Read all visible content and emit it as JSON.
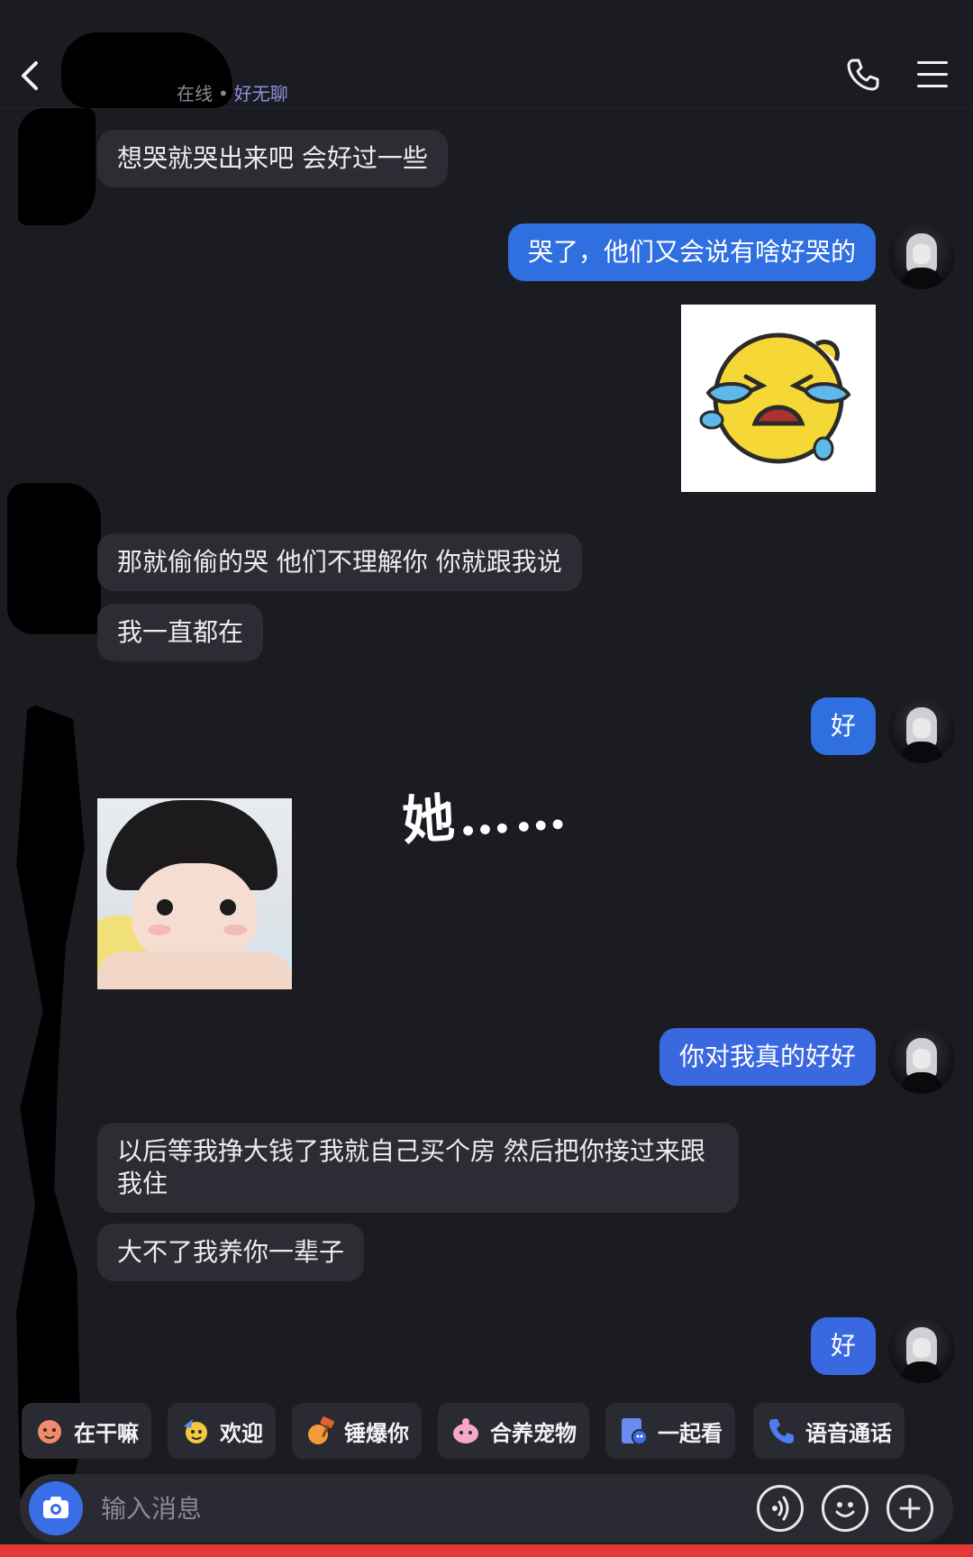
{
  "header": {
    "status_online": "在线",
    "status_sep": "•",
    "status_mood": "好无聊"
  },
  "messages": [
    {
      "from": "them",
      "text": "想哭就哭出来吧 会好过一些"
    },
    {
      "from": "me",
      "text": "哭了，他们又会说有啥好哭的"
    },
    {
      "from": "me",
      "type": "sticker",
      "sticker": "crying-face-sticker"
    },
    {
      "from": "them",
      "text": "那就偷偷的哭 他们不理解你 你就跟我说"
    },
    {
      "from": "them",
      "text": "我一直都在"
    },
    {
      "from": "me",
      "text": "好"
    },
    {
      "from": "them",
      "type": "sticker",
      "sticker": "baby-photo-sticker"
    },
    {
      "from": "me",
      "text": "你对我真的好好"
    },
    {
      "from": "them",
      "text": "以后等我挣大钱了我就自己买个房 然后把你接过来跟我住"
    },
    {
      "from": "them",
      "text": "大不了我养你一辈子"
    },
    {
      "from": "me",
      "text": "好"
    }
  ],
  "overlay_text": "她……",
  "quick_actions": [
    {
      "label": "在干嘛",
      "icon": "wave-hand-icon"
    },
    {
      "label": "欢迎",
      "icon": "party-face-icon"
    },
    {
      "label": "锤爆你",
      "icon": "hammer-icon"
    },
    {
      "label": "合养宠物",
      "icon": "pet-icon"
    },
    {
      "label": "一起看",
      "icon": "watch-together-icon"
    },
    {
      "label": "语音通话",
      "icon": "phone-icon"
    }
  ],
  "input": {
    "placeholder": "输入消息"
  },
  "colors": {
    "background": "#1b1b22",
    "incoming_bubble": "#2c2c34",
    "outgoing_bubble": "#2f6fe0",
    "accent": "#3a6ee8",
    "mood_text": "#8c93d8"
  }
}
